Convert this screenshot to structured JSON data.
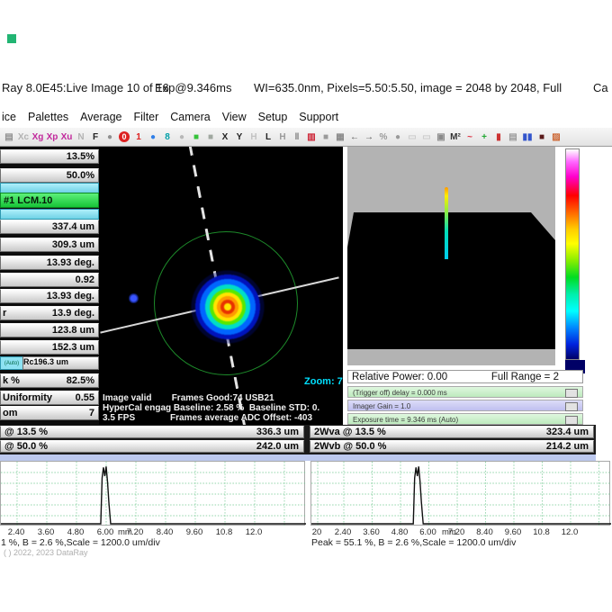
{
  "window": {
    "title_segments": [
      "Ray 8.0E45:Live Image 10 of 16",
      "Exp@9.346ms",
      "WI=635.0nm, Pixels=5.50:5.50, image = 2048 by 2048, Full",
      "Ca"
    ]
  },
  "menu": [
    "ice",
    "Palettes",
    "Average",
    "Filter",
    "Camera",
    "View",
    "Setup",
    "Support"
  ],
  "toolbar_icons": [
    {
      "n": "save",
      "v": "▤",
      "c": "#8f8f8f"
    },
    {
      "n": "xc",
      "v": "Xc",
      "c": "#b3b3b3"
    },
    {
      "n": "xg",
      "v": "Xg",
      "c": "#c2299c"
    },
    {
      "n": "xp",
      "v": "Xp",
      "c": "#c2299c"
    },
    {
      "n": "xu",
      "v": "Xu",
      "c": "#c2299c"
    },
    {
      "n": "n-mode",
      "v": "N",
      "c": "#b3b3b3"
    },
    {
      "n": "f-mode",
      "v": "F",
      "c": "#222222"
    },
    {
      "n": "grey-circle",
      "v": "●",
      "c": "#909090"
    },
    {
      "n": "zero-badge",
      "v": "0",
      "c": "#ffffff",
      "b": "#dd2222"
    },
    {
      "n": "one",
      "v": "1",
      "c": "#dd2222"
    },
    {
      "n": "info-circle",
      "v": "●",
      "c": "#2f7fe8"
    },
    {
      "n": "user",
      "v": "8",
      "c": "#00a0a8"
    },
    {
      "n": "lock",
      "v": "●",
      "c": "#b8b8b8"
    },
    {
      "n": "palette-green",
      "v": "■",
      "c": "#35c23a"
    },
    {
      "n": "palette-grey",
      "v": "■",
      "c": "#a0a8a0"
    },
    {
      "n": "x-profile",
      "v": "X",
      "c": "#222222"
    },
    {
      "n": "y-profile",
      "v": "Y",
      "c": "#222222"
    },
    {
      "n": "h-dim",
      "v": "H",
      "c": "#c2c2c2"
    },
    {
      "n": "l-profile",
      "v": "L",
      "c": "#222222"
    },
    {
      "n": "h-solid",
      "v": "H",
      "c": "#9a9a9a"
    },
    {
      "n": "pause",
      "v": "‖",
      "c": "#777777"
    },
    {
      "n": "histogram",
      "v": "▥",
      "c": "#cc2233"
    },
    {
      "n": "block",
      "v": "■",
      "c": "#9a9a9a"
    },
    {
      "n": "grid",
      "v": "▦",
      "c": "#8a8a8a"
    },
    {
      "n": "arrow-left",
      "v": "←",
      "c": "#555555"
    },
    {
      "n": "arrow-right",
      "v": "→",
      "c": "#555555"
    },
    {
      "n": "percent",
      "v": "%",
      "c": "#9a9a9a"
    },
    {
      "n": "dot",
      "v": "●",
      "c": "#9a9a9a"
    },
    {
      "n": "ghost-a",
      "v": "▭",
      "c": "#cccccc"
    },
    {
      "n": "ghost-b",
      "v": "▭",
      "c": "#cccccc"
    },
    {
      "n": "camera",
      "v": "▣",
      "c": "#8a8a8a"
    },
    {
      "n": "m2",
      "v": "M²",
      "c": "#333333"
    },
    {
      "n": "wave",
      "v": "~",
      "c": "#dd3344"
    },
    {
      "n": "plus",
      "v": "+",
      "c": "#22a833"
    },
    {
      "n": "thermo",
      "v": "▮",
      "c": "#cc3333"
    },
    {
      "n": "print",
      "v": "▤",
      "c": "#9a9a9a"
    },
    {
      "n": "bars",
      "v": "▮▮",
      "c": "#3355cc"
    },
    {
      "n": "dark-square",
      "v": "■",
      "c": "#5a1a1a"
    },
    {
      "n": "chart",
      "v": "▨",
      "c": "#cc6633"
    }
  ],
  "left_panel": {
    "rows": [
      {
        "type": "bar",
        "label": "",
        "value": "13.5%"
      },
      {
        "type": "bar",
        "label": "",
        "value": "50.0%"
      },
      {
        "type": "cyan"
      },
      {
        "type": "green",
        "label": "#1 LCM.10"
      },
      {
        "type": "cyan"
      },
      {
        "type": "bar",
        "label": "",
        "value": "337.4 um"
      },
      {
        "type": "bar",
        "label": "",
        "value": "309.3 um"
      },
      {
        "type": "bar",
        "label": "",
        "value": "13.93 deg."
      },
      {
        "type": "bar",
        "label": "",
        "value": "0.92"
      },
      {
        "type": "bar",
        "label": "",
        "value": "13.93 deg."
      },
      {
        "type": "bar",
        "label": "r",
        "value": "13.9 deg."
      },
      {
        "type": "bar",
        "label": "",
        "value": "123.8 um"
      },
      {
        "type": "bar",
        "label": "",
        "value": "152.3 um"
      },
      {
        "type": "rc",
        "auto": "(Auto)",
        "label": "Rc",
        "value": "196.3 um"
      },
      {
        "type": "bar",
        "label": "k %",
        "value": "82.5%"
      },
      {
        "type": "bar",
        "label": "Uniformity",
        "value": "0.55"
      },
      {
        "type": "bar",
        "label": "om",
        "value": "7"
      }
    ]
  },
  "beam": {
    "zoom": "Zoom: 7",
    "status": [
      "Image valid        Frames Good:74 USB21",
      "HyperCal engag Baseline: 2.58 %  Baseline STD: 0.",
      "3.5 FPS              Frames average ADC Offset: -403"
    ]
  },
  "power": {
    "left": "Relative Power: 0.00",
    "right": "Full Range = 2"
  },
  "sliders": [
    {
      "label": "(Trigger off) delay = 0.000 ms",
      "tone": "green"
    },
    {
      "label": "Imager Gain = 1.0",
      "tone": "blue"
    },
    {
      "label": "Exposure time = 9.346 ms (Auto)",
      "tone": "green"
    }
  ],
  "measures": [
    {
      "label": "@ 13.5 %",
      "value": "336.3 um"
    },
    {
      "label": "2Wva @ 13.5 %",
      "value": "323.4 um"
    },
    {
      "label": "@ 50.0 %",
      "value": "242.0 um"
    },
    {
      "label": "2Wvb @ 50.0 %",
      "value": "214.2 um"
    }
  ],
  "chart_data": [
    {
      "type": "line",
      "side": "left",
      "x_unit": "mm",
      "x_ticks": [
        "2.40",
        "3.60",
        "4.80",
        "6.00",
        "7.20",
        "8.40",
        "9.60",
        "10.8",
        "12.0"
      ],
      "peak_x_mm": 6.0,
      "peak_percent": 55.1,
      "baseline_percent": 2.6,
      "scale_per_div": "1200.0 um/div",
      "caption": "1 %, B = 2.6 %,Scale = 1200.0 um/div",
      "spike_x_frac": 0.345,
      "spike_height_frac": 0.95,
      "grid": true
    },
    {
      "type": "line",
      "side": "right",
      "x_unit": "mm",
      "x_ticks": [
        "20",
        "2.40",
        "3.60",
        "4.80",
        "6.00",
        "7.20",
        "8.40",
        "9.60",
        "10.8",
        "12.0"
      ],
      "peak_x_mm": 6.0,
      "peak_percent": 55.1,
      "baseline_percent": 2.6,
      "scale_per_div": "1200.0 um/div",
      "caption": "Peak = 55.1 %, B = 2.6 %,Scale = 1200.0 um/div",
      "spike_x_frac": 0.358,
      "spike_height_frac": 0.95,
      "grid": true
    }
  ],
  "footer": {
    "copyright": "( ) 2022, 2023 DataRay"
  }
}
